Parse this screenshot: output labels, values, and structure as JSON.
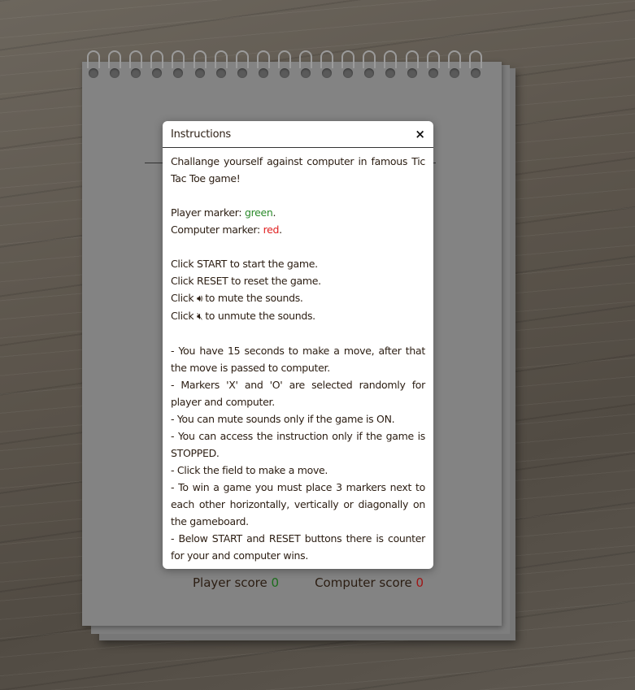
{
  "modal": {
    "title": "Instructions",
    "close_label": "×",
    "intro": "Challange yourself against computer in famous Tic Tac Toe game!",
    "player_marker_label": "Player marker: ",
    "player_marker_value": "green",
    "computer_marker_label": "Computer marker: ",
    "computer_marker_value": "red",
    "click_start": "Click START to start the game.",
    "click_reset": "Click RESET to reset the game.",
    "click_prefix": "Click ",
    "mute_suffix": " to mute the sounds.",
    "unmute_suffix": " to unmute the sounds.",
    "mute_icon": "🔊︎",
    "unmute_icon": "🔇︎",
    "rules": [
      "- You have 15 seconds to make a move, after that the move is passed to computer.",
      "- Markers 'X' and 'O' are selected randomly for player and computer.",
      "- You can mute sounds only if the game is ON.",
      "- You can access the instruction only if the game is STOPPED.",
      "- Click the field to make a move.",
      "- To win a game you must place 3 markers next to each other horizontally, vertically or diagonally on the gameboard.",
      "- Below START and RESET buttons there is counter for your and computer wins."
    ]
  },
  "scores": {
    "player_label": "Player score ",
    "player_value": "0",
    "computer_label": "Computer score ",
    "computer_value": "0"
  },
  "icons": {
    "mute": "speaker-icon",
    "unmute": "speaker-muted-icon"
  }
}
